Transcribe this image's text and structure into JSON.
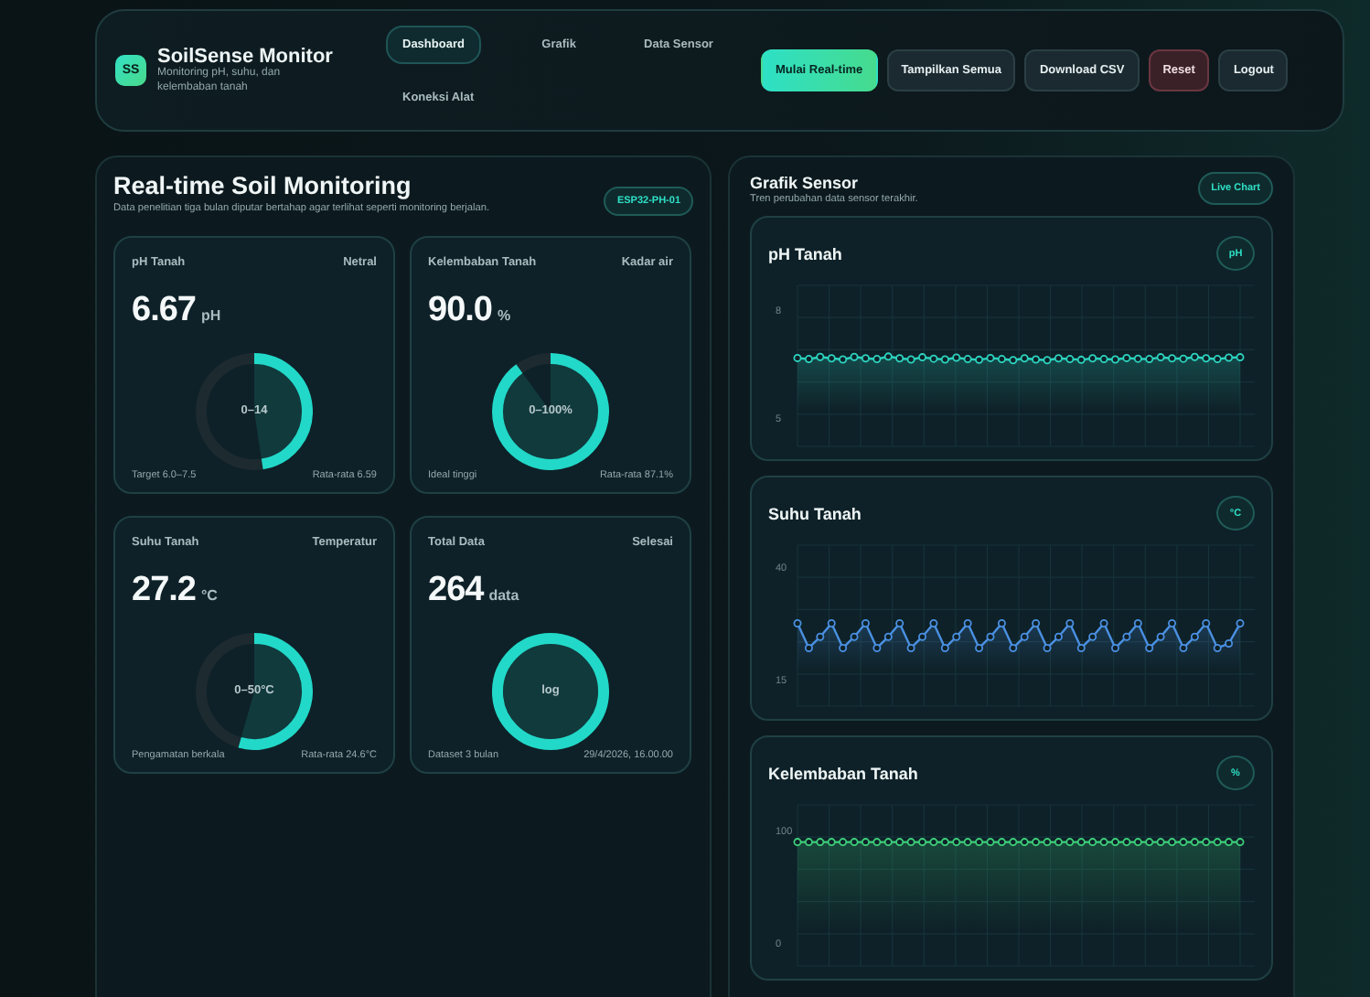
{
  "app": {
    "logo": "SS",
    "title": "SoilSense Monitor",
    "subtitle": "Monitoring pH, suhu, dan kelembaban tanah"
  },
  "nav": [
    {
      "label": "Dashboard",
      "selected": true
    },
    {
      "label": "Grafik",
      "selected": false
    },
    {
      "label": "Data Sensor",
      "selected": false
    },
    {
      "label": "Koneksi Alat",
      "selected": false
    }
  ],
  "actions": [
    {
      "label": "Mulai Real-time",
      "kind": "primary"
    },
    {
      "label": "Tampilkan Semua",
      "kind": "default"
    },
    {
      "label": "Download CSV",
      "kind": "default"
    },
    {
      "label": "Reset",
      "kind": "danger"
    },
    {
      "label": "Logout",
      "kind": "default"
    }
  ],
  "monitoring": {
    "title": "Real-time Soil Monitoring",
    "description": "Data penelitian tiga bulan diputar bertahap agar terlihat seperti monitoring berjalan.",
    "device_badge": "ESP32-PH-01",
    "cards": [
      {
        "label": "pH Tanah",
        "status": "Netral",
        "value": "6.67",
        "unit": "pH",
        "gauge_label": "0–14",
        "level": 0.476,
        "footer_left": "Target 6.0–7.5",
        "footer_right": "Rata-rata 6.59"
      },
      {
        "label": "Kelembaban Tanah",
        "status": "Kadar air",
        "value": "90.0",
        "unit": "%",
        "gauge_label": "0–100%",
        "level": 0.9,
        "footer_left": "Ideal tinggi",
        "footer_right": "Rata-rata 87.1%"
      },
      {
        "label": "Suhu Tanah",
        "status": "Temperatur",
        "value": "27.2",
        "unit": "°C",
        "gauge_label": "0–50°C",
        "level": 0.544,
        "footer_left": "Pengamatan berkala",
        "footer_right": "Rata-rata 24.6°C"
      },
      {
        "label": "Total Data",
        "status": "Selesai",
        "value": "264",
        "unit": "data",
        "gauge_label": "log",
        "level": 1,
        "footer_left": "Dataset 3 bulan",
        "footer_right": "29/4/2026, 16.00.00"
      }
    ]
  },
  "charts_panel": {
    "title": "Grafik Sensor",
    "subtitle": "Tren perubahan data sensor terakhir.",
    "badge": "Live Chart",
    "charts": [
      {
        "title": "pH Tanah",
        "badge": "pH",
        "chart_data": {
          "type": "line",
          "grid": true,
          "ylim": [
            4.2,
            8.7
          ],
          "yticks": [
            5,
            8
          ],
          "series": [
            {
              "marker": "circle",
              "color": "#2dd4bf",
              "values": [
                6.67,
                6.64,
                6.7,
                6.66,
                6.63,
                6.7,
                6.66,
                6.64,
                6.71,
                6.66,
                6.63,
                6.69,
                6.65,
                6.63,
                6.68,
                6.64,
                6.62,
                6.67,
                6.64,
                6.61,
                6.66,
                6.63,
                6.61,
                6.66,
                6.64,
                6.62,
                6.66,
                6.64,
                6.63,
                6.67,
                6.65,
                6.64,
                6.69,
                6.66,
                6.65,
                6.7,
                6.66,
                6.64,
                6.68,
                6.69
              ]
            }
          ]
        }
      },
      {
        "title": "Suhu Tanah",
        "badge": "°C",
        "chart_data": {
          "type": "line",
          "grid": true,
          "ylim": [
            9,
            45
          ],
          "yticks": [
            15,
            40
          ],
          "series": [
            {
              "marker": "circle",
              "color": "#4a90e2",
              "values": [
                27.5,
                22,
                24.5,
                27.5,
                22,
                24.5,
                27.5,
                22,
                24.5,
                27.5,
                22,
                24.5,
                27.5,
                22,
                24.5,
                27.5,
                22,
                24.5,
                27.5,
                22,
                24.5,
                27.5,
                22,
                24.5,
                27.5,
                22,
                24.5,
                27.5,
                22,
                24.5,
                27.5,
                22,
                24.5,
                27.5,
                22,
                24.5,
                27.5,
                22,
                23,
                27.5
              ]
            }
          ]
        }
      },
      {
        "title": "Kelembaban Tanah",
        "badge": "%",
        "chart_data": {
          "type": "line",
          "grid": true,
          "ylim": [
            -20,
            123
          ],
          "yticks": [
            0,
            100
          ],
          "series": [
            {
              "marker": "circle",
              "color": "#3ecf7a",
              "values": [
                90,
                90,
                90,
                90,
                90,
                90,
                90,
                90,
                90,
                90,
                90,
                90,
                90,
                90,
                90,
                90,
                90,
                90,
                90,
                90,
                90,
                90,
                90,
                90,
                90,
                90,
                90,
                90,
                90,
                90,
                90,
                90,
                90,
                90,
                90,
                90,
                90,
                90,
                90,
                90
              ]
            }
          ]
        }
      }
    ]
  }
}
